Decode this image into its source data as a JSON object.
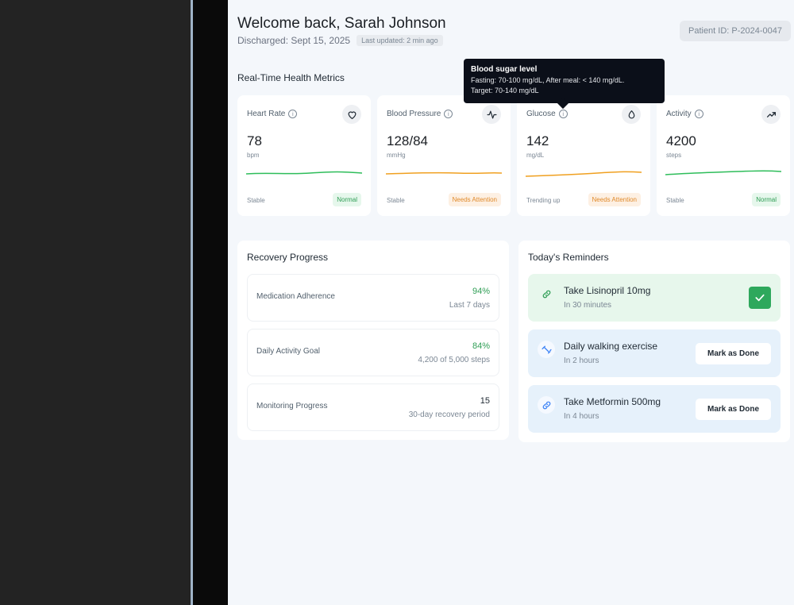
{
  "header": {
    "welcome": "Welcome back, Sarah Johnson",
    "discharged": "Discharged: Sept 15, 2025",
    "last_updated": "Last updated: 2 min ago",
    "patient_id": "Patient ID: P-2024-0047"
  },
  "metrics_section": {
    "title": "Real-Time Health Metrics",
    "cards": [
      {
        "label": "Heart Rate",
        "value": "78",
        "unit": "bpm",
        "status": "Stable",
        "badge": "Normal",
        "icon": "heart-icon",
        "trend_color": "#2ebd5a"
      },
      {
        "label": "Blood Pressure",
        "value": "128/84",
        "unit": "mmHg",
        "status": "Stable",
        "badge": "Needs Attention",
        "icon": "activity-icon",
        "trend_color": "#f0a020"
      },
      {
        "label": "Glucose",
        "value": "142",
        "unit": "mg/dL",
        "status": "Trending up",
        "badge": "Needs Attention",
        "icon": "droplet-icon",
        "trend_color": "#f0a020"
      },
      {
        "label": "Activity",
        "value": "4200",
        "unit": "steps",
        "status": "Stable",
        "badge": "Normal",
        "icon": "trending-up-icon",
        "trend_color": "#2ebd5a"
      }
    ]
  },
  "tooltip": {
    "title": "Blood sugar level",
    "line1": "Fasting: 70-100 mg/dL, After meal: < 140 mg/dL.",
    "line2": "Target: 70-140 mg/dL"
  },
  "recovery": {
    "title": "Recovery Progress",
    "items": [
      {
        "label": "Medication Adherence",
        "value": "94%",
        "detail": "Last 7 days"
      },
      {
        "label": "Daily Activity Goal",
        "value": "84%",
        "detail": "4,200 of 5,000 steps"
      },
      {
        "label": "Monitoring Progress",
        "value": "15",
        "detail": "30-day recovery period"
      }
    ]
  },
  "reminders": {
    "title": "Today's Reminders",
    "items": [
      {
        "title": "Take Lisinopril 10mg",
        "time": "In 30 minutes",
        "state": "done",
        "icon": "link-icon"
      },
      {
        "title": "Daily walking exercise",
        "time": "In 2 hours",
        "state": "pending",
        "button": "Mark as Done",
        "icon": "dumbbell-icon"
      },
      {
        "title": "Take Metformin 500mg",
        "time": "In 4 hours",
        "state": "pending",
        "button": "Mark as Done",
        "icon": "link-icon"
      }
    ]
  },
  "colors": {
    "normal": "#2f9e55",
    "attention": "#e08a2b",
    "done_bg": "#e7f7ec",
    "pending_bg": "#e6f1fb"
  }
}
